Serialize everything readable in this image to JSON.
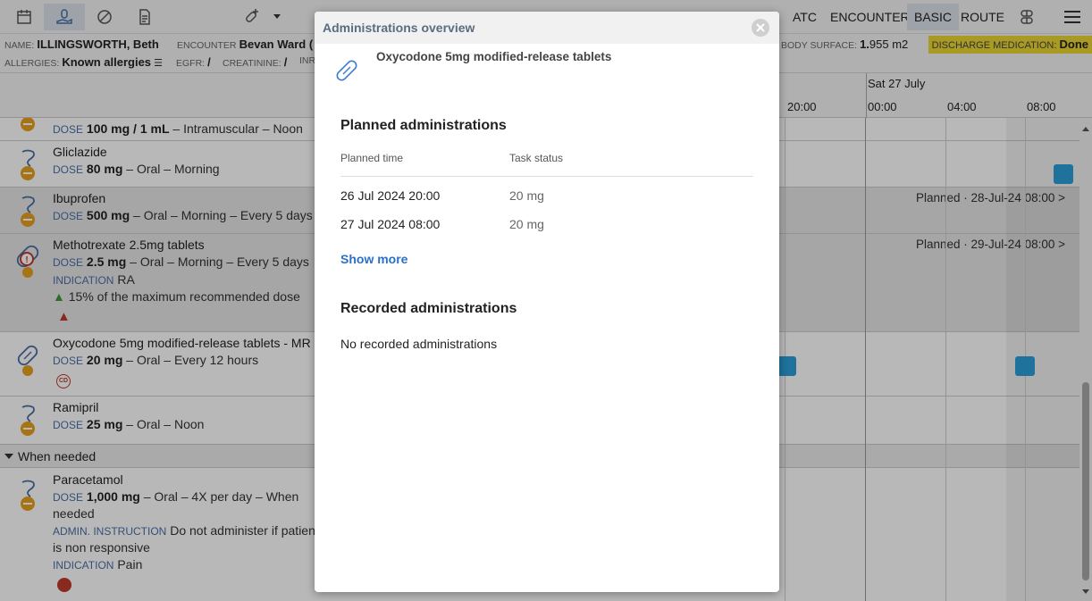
{
  "toolbar": {
    "atc_label": "ATC",
    "encounter_label": "ENCOUNTER",
    "basic_label": "BASIC",
    "route_label": "ROUTE"
  },
  "banner": {
    "name_label": "NAME:",
    "name_value": "ILLINGSWORTH, Beth",
    "encounter_label": "ENCOUNTER",
    "encounter_value": "Bevan Ward (",
    "body_surface_label": "BODY SURFACE:",
    "body_surface_value": "1.",
    "body_surface_rest": "955 m2",
    "discharge_label": "DISCHARGE MEDICATION:",
    "discharge_value": "Done",
    "allergies_label": "ALLERGIES:",
    "allergies_value": "Known allergies",
    "egfr_label": "EGFR:",
    "egfr_value": "/",
    "creatinine_label": "CREATININE:",
    "creatinine_value": "/",
    "trailing_label": "INR"
  },
  "timeline": {
    "day_label": "Sat 27 July",
    "hours": [
      "20:00",
      "00:00",
      "04:00",
      "08:00"
    ]
  },
  "rows": [
    {
      "name": "",
      "dose_label": "DOSE",
      "dose": "100 mg / 1 mL",
      "details": "– Intramuscular – Noon"
    },
    {
      "name": "Gliclazide",
      "dose_label": "DOSE",
      "dose": "80 mg",
      "details": "– Oral – Morning"
    },
    {
      "name": "Ibuprofen",
      "dose_label": "DOSE",
      "dose": "500 mg",
      "details": "– Oral – Morning – Every 5 days",
      "planned": "Planned · 28-Jul-24 08:00 >"
    },
    {
      "name": "Methotrexate 2.5mg tablets",
      "dose_label": "DOSE",
      "dose": "2.5 mg",
      "details": "– Oral – Morning – Every 5 days",
      "indication_label": "INDICATION",
      "indication": "RA",
      "warning": "15% of the maximum recommended dose",
      "planned": "Planned · 29-Jul-24 08:00 >"
    },
    {
      "name": "Oxycodone 5mg modified-release tablets - MR",
      "dose_label": "DOSE",
      "dose": "20 mg",
      "details": "– Oral – Every 12 hours",
      "badge": "CD"
    },
    {
      "name": "Ramipril",
      "dose_label": "DOSE",
      "dose": "25 mg",
      "details": "– Oral – Noon"
    },
    {
      "name": "Paracetamol",
      "dose_label": "DOSE",
      "dose": "1,000 mg",
      "details": "– Oral – 4X per day – When",
      "details2": "needed",
      "admin_label": "ADMIN. INSTRUCTION",
      "admin": "Do not administer if patient",
      "admin2": "is non responsive",
      "indication_label": "INDICATION",
      "indication": "Pain"
    }
  ],
  "group": {
    "label": "When needed"
  },
  "modal": {
    "title": "Administrations overview",
    "medication": "Oxycodone 5mg modified-release tablets",
    "planned_title": "Planned administrations",
    "col_time": "Planned time",
    "col_status": "Task status",
    "planned": [
      {
        "time": "26 Jul 2024 20:00",
        "status": "20 mg"
      },
      {
        "time": "27 Jul 2024 08:00",
        "status": "20 mg"
      }
    ],
    "show_more": "Show more",
    "recorded_title": "Recorded administrations",
    "no_recorded": "No recorded administrations"
  },
  "colors": {
    "accent_blue": "#2a9fd8",
    "link_blue": "#2a6fc9",
    "discharge_yellow": "#e9d631",
    "warning_red": "#c0392b"
  }
}
